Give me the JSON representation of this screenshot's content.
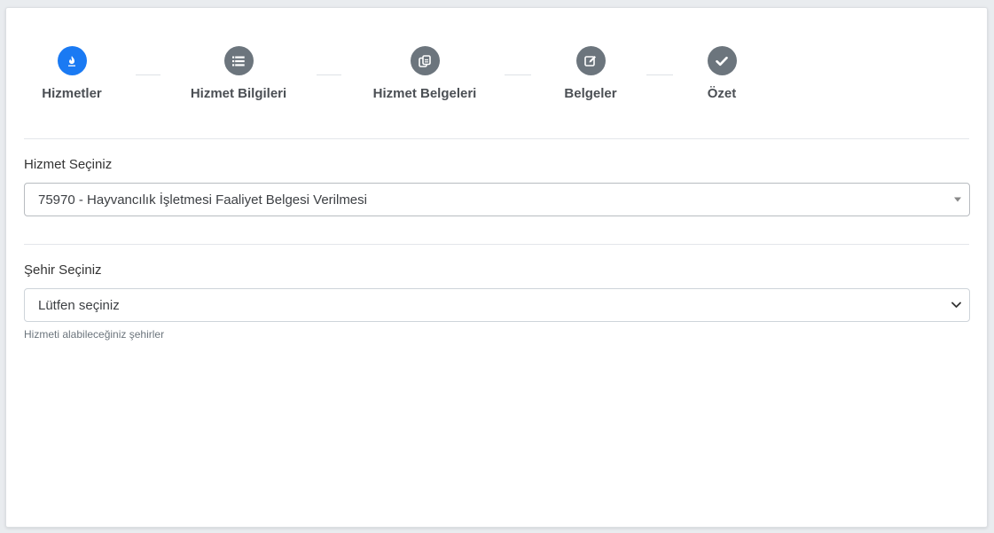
{
  "wizard": {
    "steps": [
      {
        "label": "Hizmetler",
        "icon": "fire-icon",
        "active": true
      },
      {
        "label": "Hizmet Bilgileri",
        "icon": "list-icon",
        "active": false
      },
      {
        "label": "Hizmet Belgeleri",
        "icon": "copy-icon",
        "active": false
      },
      {
        "label": "Belgeler",
        "icon": "edit-icon",
        "active": false
      },
      {
        "label": "Özet",
        "icon": "check-icon",
        "active": false
      }
    ],
    "colors": {
      "active": "#1a7af3",
      "inactive": "#6c757d"
    }
  },
  "service": {
    "label": "Hizmet Seçiniz",
    "selected": "75970 - Hayvancılık İşletmesi Faaliyet Belgesi Verilmesi"
  },
  "city": {
    "label": "Şehir Seçiniz",
    "selected": "Lütfen seçiniz",
    "help": "Hizmeti alabileceğiniz şehirler"
  }
}
